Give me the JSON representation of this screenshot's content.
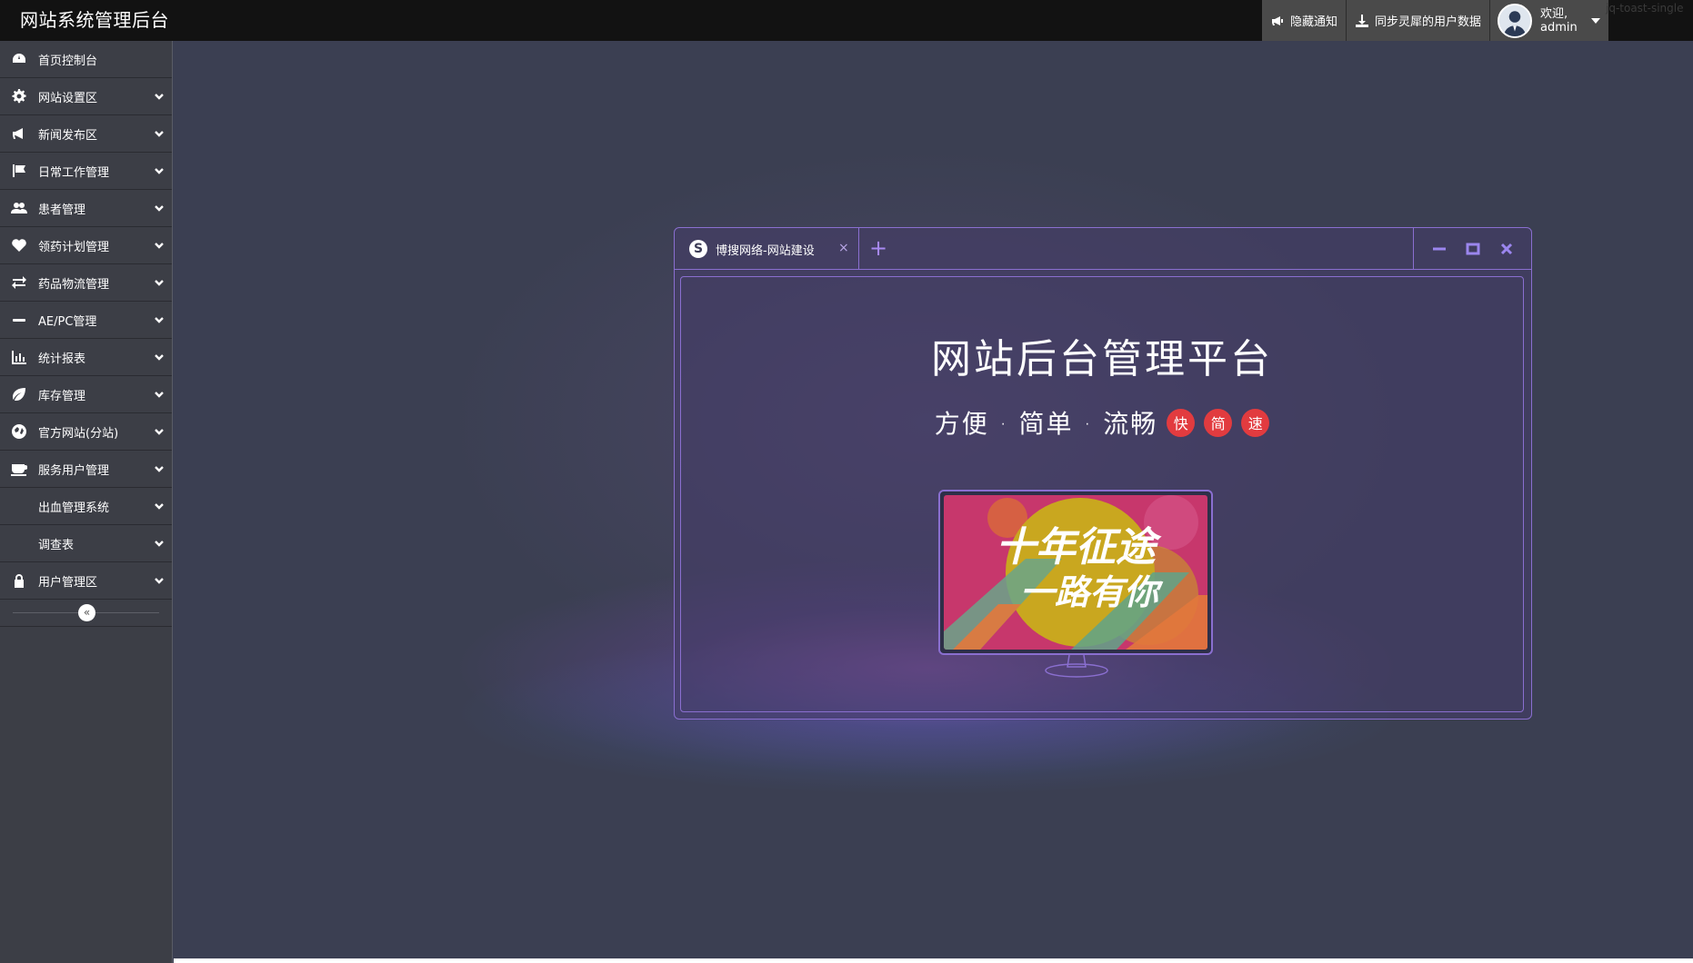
{
  "app": {
    "title": "网站系统管理后台",
    "overlay_text": "jq-toast-single"
  },
  "topbar": {
    "hide_notice_label": "隐藏通知",
    "sync_label": "同步灵犀的用户数据",
    "welcome_label": "欢迎,",
    "username": "admin"
  },
  "sidebar": {
    "items": [
      {
        "label": "首页控制台",
        "icon": "dashboard-icon",
        "has_children": false
      },
      {
        "label": "网站设置区",
        "icon": "gear-icon",
        "has_children": true
      },
      {
        "label": "新闻发布区",
        "icon": "megaphone-icon",
        "has_children": true
      },
      {
        "label": "日常工作管理",
        "icon": "flag-icon",
        "has_children": true
      },
      {
        "label": "患者管理",
        "icon": "users-icon",
        "has_children": true
      },
      {
        "label": "领药计划管理",
        "icon": "heart-icon",
        "has_children": true
      },
      {
        "label": "药品物流管理",
        "icon": "exchange-icon",
        "has_children": true
      },
      {
        "label": "AE/PC管理",
        "icon": "minus-icon",
        "has_children": true
      },
      {
        "label": "统计报表",
        "icon": "bar-chart-icon",
        "has_children": true
      },
      {
        "label": "库存管理",
        "icon": "leaf-icon",
        "has_children": true
      },
      {
        "label": "官方网站(分站)",
        "icon": "globe-icon",
        "has_children": true
      },
      {
        "label": "服务用户管理",
        "icon": "coffee-icon",
        "has_children": true
      },
      {
        "label": "出血管理系统",
        "icon": "",
        "has_children": true
      },
      {
        "label": "调查表",
        "icon": "",
        "has_children": true
      },
      {
        "label": "用户管理区",
        "icon": "lock-icon",
        "has_children": true
      }
    ],
    "collapse_glyph": "«"
  },
  "window": {
    "tab_title": "博搜网络-网站建设",
    "tab_close": "×",
    "tab_add": "+",
    "headline": "网站后台管理平台",
    "subline": "方便 · 简单 · 流畅",
    "badges": [
      "快",
      "简",
      "速"
    ],
    "banner_line1": "十年征途",
    "banner_line2": "一路有你"
  },
  "colors": {
    "topbar_bg": "#121212",
    "sidebar_bg": "#3c3e46",
    "accent_purple": "#8a6fd0",
    "badge_red": "#e23b3f",
    "banner_magenta": "#c7376c",
    "banner_gold": "#c9a71f"
  }
}
